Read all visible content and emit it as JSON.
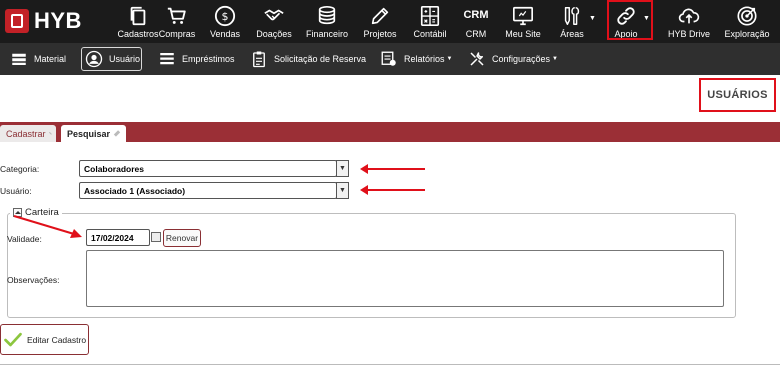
{
  "app": {
    "logo_text": "HYB"
  },
  "topnav": {
    "items": [
      {
        "label": "Cadastros",
        "icon": "copy-icon"
      },
      {
        "label": "Compras",
        "icon": "cart-icon"
      },
      {
        "label": "Vendas",
        "icon": "dollar-icon"
      },
      {
        "label": "Doações",
        "icon": "handshake-icon"
      },
      {
        "label": "Financeiro",
        "icon": "coins-icon"
      },
      {
        "label": "Projetos",
        "icon": "pencil-icon"
      },
      {
        "label": "Contábil",
        "icon": "calculator-icon"
      },
      {
        "label": "CRM",
        "icon_text": "CRM"
      },
      {
        "label": "Meu Site",
        "icon": "monitor-icon"
      },
      {
        "label": "Áreas",
        "icon": "tools-icon"
      },
      {
        "label": "Apoio",
        "icon": "link-icon"
      },
      {
        "label": "HYB Drive",
        "icon": "cloud-upload-icon"
      },
      {
        "label": "Exploração",
        "icon": "target-icon"
      }
    ]
  },
  "subnav": {
    "items": [
      {
        "label": "Material",
        "icon": "material-icon"
      },
      {
        "label": "Usuário",
        "icon": "user-icon"
      },
      {
        "label": "Empréstimos",
        "icon": "list-icon"
      },
      {
        "label": "Solicitação de Reserva",
        "icon": "clipboard-icon"
      },
      {
        "label": "Relatórios",
        "icon": "report-icon"
      },
      {
        "label": "Configurações",
        "icon": "wrench-icon"
      }
    ]
  },
  "page": {
    "title": "USUÁRIOS",
    "tabs": [
      "Cadastrar",
      "Pesquisar"
    ],
    "active_tab": "Pesquisar"
  },
  "form": {
    "categoria_label": "Categoria:",
    "categoria_value": "Colaboradores",
    "usuario_label": "Usuário:",
    "usuario_value": "Associado 1 (Associado)",
    "fieldset_legend": "Carteira",
    "validade_label": "Validade:",
    "validade_value": "17/02/2024",
    "renovar_label": "Renovar",
    "observacoes_label": "Observações:",
    "observacoes_value": "",
    "edit_button_label": "Editar Cadastro"
  },
  "colors": {
    "accent": "#9b2f36",
    "highlight": "#e0101a",
    "topbar_bg": "#1b1b1b",
    "subbar_bg": "#2f2f2f",
    "check": "#8cc63f"
  }
}
